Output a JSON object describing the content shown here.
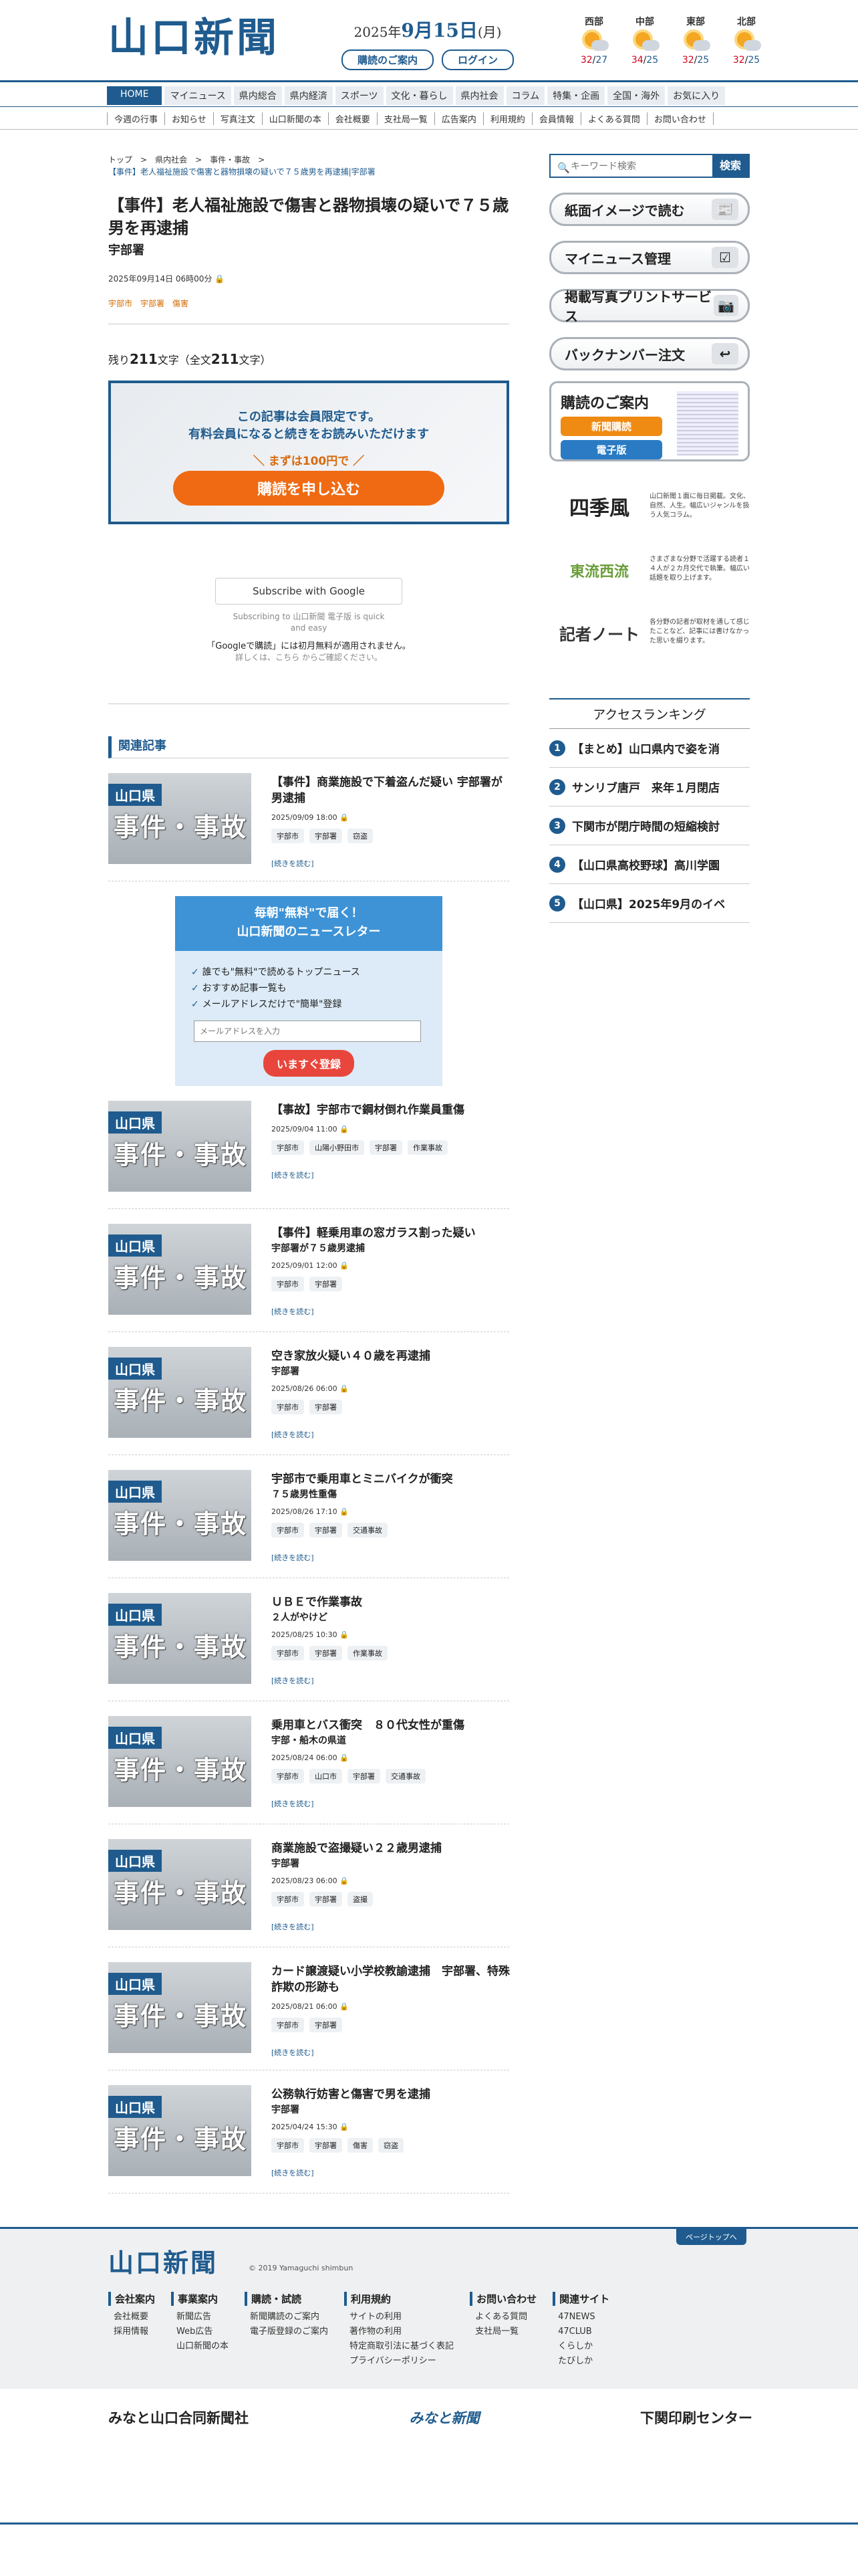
{
  "header": {
    "logo": "山口新聞",
    "date_year": "2025年",
    "date_md": "9月15日",
    "date_wd": "(月)",
    "subscribe_btn": "購読のご案内",
    "login_btn": "ログイン",
    "weather": [
      {
        "region": "西部",
        "hi": "32",
        "lo": "27"
      },
      {
        "region": "中部",
        "hi": "34",
        "lo": "25"
      },
      {
        "region": "東部",
        "hi": "32",
        "lo": "25"
      },
      {
        "region": "北部",
        "hi": "32",
        "lo": "25"
      }
    ]
  },
  "nav_primary": [
    "HOME",
    "マイニュース",
    "県内総合",
    "県内経済",
    "スポーツ",
    "文化・暮らし",
    "県内社会",
    "コラム",
    "特集・企画",
    "全国・海外",
    "お気に入り"
  ],
  "nav_secondary": [
    "今週の行事",
    "お知らせ",
    "写真注文",
    "山口新聞の本",
    "会社概要",
    "支社局一覧",
    "広告案内",
    "利用規約",
    "会員情報",
    "よくある質問",
    "お問い合わせ"
  ],
  "breadcrumb": {
    "items": [
      "トップ",
      "県内社会",
      "事件・事故"
    ],
    "current": "【事件】老人福祉施設で傷害と器物損壊の疑いで７５歳男を再逮捕|宇部署"
  },
  "article": {
    "title": "【事件】老人福祉施設で傷害と器物損壊の疑いで７５歳男を再逮捕",
    "subtitle": "宇部署",
    "datetime": "2025年09月14日 06時00分",
    "tags": [
      "宇部市",
      "宇部署",
      "傷害"
    ],
    "remain_prefix": "残り",
    "remain_num": "211",
    "remain_mid": "文字（全文",
    "total_num": "211",
    "remain_suffix": "文字）"
  },
  "paywall": {
    "line1": "この記事は会員限定です。",
    "line2": "有料会員になると続きをお読みいただけます",
    "price": "＼ まずは100円で ／",
    "button": "購読を申し込む"
  },
  "google": {
    "button": "Subscribe with Google",
    "sub1": "Subscribing to 山口新聞 電子版 is quick",
    "sub2": "and easy",
    "note": "「Googleで購読」には初月無料が適用されません。",
    "note2": "詳しくは、こちら からご確認ください。"
  },
  "related_heading": "関連記事",
  "thumb": {
    "pref": "山口県",
    "cat": "事件・事故"
  },
  "more_label": "[続きを読む]",
  "related": [
    {
      "title": "【事件】商業施設で下着盗んだ疑い 宇部署が男逮捕",
      "sub": "",
      "date": "2025/09/09 18:00",
      "tags": [
        "宇部市",
        "宇部署",
        "窃盗"
      ]
    },
    {
      "title": "【事故】宇部市で鋼材倒れ作業員重傷",
      "sub": "",
      "date": "2025/09/04 11:00",
      "tags": [
        "宇部市",
        "山陽小野田市",
        "宇部署",
        "作業事故"
      ]
    },
    {
      "title": "【事件】軽乗用車の窓ガラス割った疑い",
      "sub": "宇部署が７５歳男逮捕",
      "date": "2025/09/01 12:00",
      "tags": [
        "宇部市",
        "宇部署"
      ]
    },
    {
      "title": "空き家放火疑い４０歳を再逮捕",
      "sub": "宇部署",
      "date": "2025/08/26 06:00",
      "tags": [
        "宇部市",
        "宇部署"
      ]
    },
    {
      "title": "宇部市で乗用車とミニバイクが衝突",
      "sub": "７５歳男性重傷",
      "date": "2025/08/26 17:10",
      "tags": [
        "宇部市",
        "宇部署",
        "交通事故"
      ]
    },
    {
      "title": "ＵＢＥで作業事故",
      "sub": "２人がやけど",
      "date": "2025/08/25 10:30",
      "tags": [
        "宇部市",
        "宇部署",
        "作業事故"
      ]
    },
    {
      "title": "乗用車とバス衝突　８０代女性が重傷",
      "sub": "宇部・船木の県道",
      "date": "2025/08/24 06:00",
      "tags": [
        "宇部市",
        "山口市",
        "宇部署",
        "交通事故"
      ]
    },
    {
      "title": "商業施設で盗撮疑い２２歳男逮捕",
      "sub": "宇部署",
      "date": "2025/08/23 06:00",
      "tags": [
        "宇部市",
        "宇部署",
        "盗撮"
      ]
    },
    {
      "title": "カード譲渡疑い小学校教諭逮捕　宇部署、特殊詐欺の形跡も",
      "sub": "",
      "date": "2025/08/21 06:00",
      "tags": [
        "宇部市",
        "宇部署"
      ]
    },
    {
      "title": "公務執行妨害と傷害で男を逮捕",
      "sub": "宇部署",
      "date": "2025/04/24 15:30",
      "tags": [
        "宇部市",
        "宇部署",
        "傷害",
        "窃盗"
      ]
    }
  ],
  "newsletter": {
    "head1": "毎朝\"無料\"で届く！",
    "head2": "山口新聞のニュースレター",
    "points": [
      "誰でも\"無料\"で読めるトップニュース",
      "おすすめ記事一覧も",
      "メールアドレスだけで\"簡単\"登録"
    ],
    "placeholder": "メールアドレスを入力",
    "button": "いますぐ登録"
  },
  "sidebar": {
    "search_placeholder": "キーワード検索",
    "search_btn": "検索",
    "buttons": [
      "紙面イメージで読む",
      "マイニュース管理",
      "掲載写真プリントサービス",
      "バックナンバー注文"
    ],
    "guide_title": "購読のご案内",
    "guide_new": "新聞購読",
    "guide_digital": "電子版",
    "promos": [
      {
        "logo": "四季風",
        "text": "山口新聞１面に毎日掲載。文化、自然、人生。幅広いジャンルを扱う人気コラム。"
      },
      {
        "logo": "東流西流",
        "text": "さまざまな分野で活躍する読者１４人が２カ月交代で執筆。幅広い話題を取り上げます。"
      },
      {
        "logo": "記者ノート",
        "text": "各分野の記者が取材を通して感じたことなど、記事には書けなかった思いを綴ります。"
      }
    ],
    "ranking_title": "アクセスランキング",
    "ranking": [
      "【まとめ】山口県内で姿を消",
      "サンリブ唐戸　来年１月閉店",
      "下関市が閉庁時間の短縮検討",
      "【山口県高校野球】高川学園",
      "【山口県】2025年9月のイベ"
    ]
  },
  "footer": {
    "logo": "山口新聞",
    "copyright": "© 2019 Yamaguchi shimbun",
    "pagetop": "ページトップへ",
    "cols": [
      {
        "h": "会社案内",
        "items": [
          "会社概要",
          "採用情報"
        ]
      },
      {
        "h": "事業案内",
        "items": [
          "新聞広告",
          "Web広告",
          "山口新聞の本"
        ]
      },
      {
        "h": "購読・試読",
        "items": [
          "新聞購読のご案内",
          "電子版登録のご案内"
        ]
      },
      {
        "h": "利用規約",
        "items": [
          "サイトの利用",
          "著作物の利用",
          "特定商取引法に基づく表記",
          "プライバシーポリシー"
        ]
      },
      {
        "h": "お問い合わせ",
        "items": [
          "よくある質問",
          "支社局一覧"
        ]
      },
      {
        "h": "関連サイト",
        "items": [
          "47NEWS",
          "47CLUB",
          "くらしか",
          "たびしか"
        ]
      }
    ],
    "sisters": [
      "みなと山口合同新聞社",
      "みなと新聞",
      "下関印刷センター"
    ]
  },
  "colors": {
    "brand": "#1f5b8e",
    "accent": "#ef6a12"
  }
}
